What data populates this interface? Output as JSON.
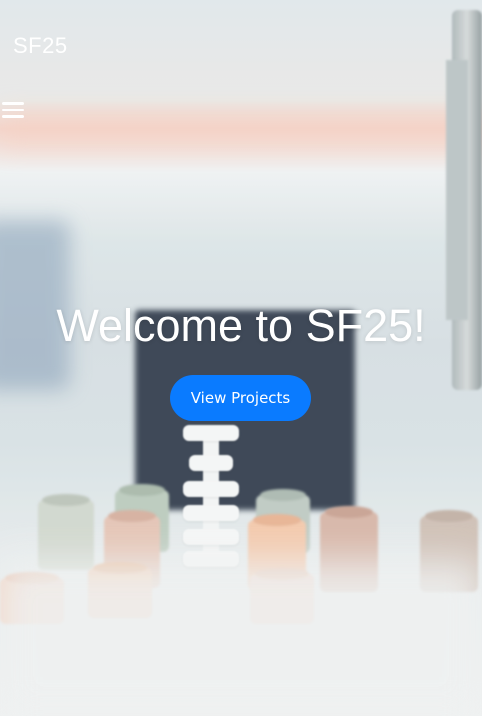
{
  "header": {
    "brand": "SF25"
  },
  "nav": {
    "menu_icon": "hamburger-menu-icon"
  },
  "hero": {
    "title": "Welcome to SF25!",
    "cta_label": "View Projects"
  },
  "colors": {
    "cta_background": "#0a7bff",
    "text": "#ffffff"
  }
}
